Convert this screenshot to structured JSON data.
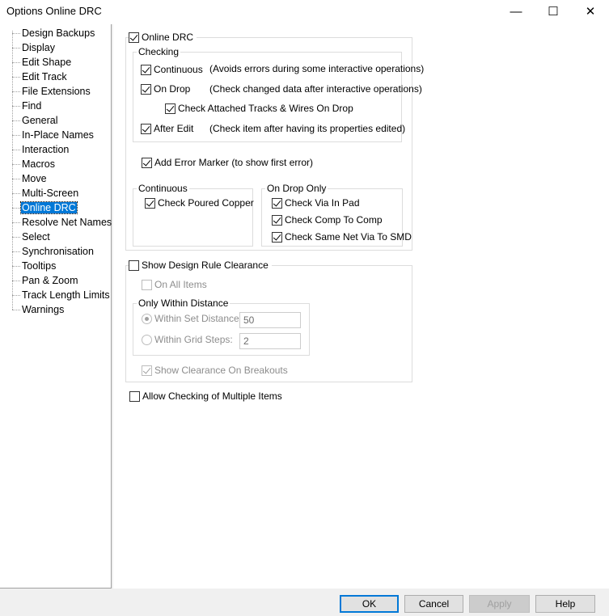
{
  "window": {
    "title": "Options  Online DRC",
    "controls": {
      "minimize": "—",
      "maximize": "☐",
      "close": "✕"
    }
  },
  "tree": {
    "items": [
      {
        "label": "Design Backups"
      },
      {
        "label": "Display"
      },
      {
        "label": "Edit Shape"
      },
      {
        "label": "Edit Track"
      },
      {
        "label": "File Extensions"
      },
      {
        "label": "Find"
      },
      {
        "label": "General"
      },
      {
        "label": "In-Place Names"
      },
      {
        "label": "Interaction"
      },
      {
        "label": "Macros"
      },
      {
        "label": "Move"
      },
      {
        "label": "Multi-Screen"
      },
      {
        "label": "Online DRC",
        "selected": true
      },
      {
        "label": "Resolve Net Names"
      },
      {
        "label": "Select"
      },
      {
        "label": "Synchronisation"
      },
      {
        "label": "Tooltips"
      },
      {
        "label": "Pan & Zoom"
      },
      {
        "label": "Track Length Limits"
      },
      {
        "label": "Warnings"
      }
    ]
  },
  "online_drc": {
    "label": "Online DRC",
    "checked": true,
    "checking": {
      "title": "Checking",
      "continuous": {
        "label": "Continuous",
        "checked": true,
        "note": "(Avoids errors during some interactive operations)"
      },
      "on_drop": {
        "label": "On Drop",
        "checked": true,
        "note": "(Check changed data after interactive operations)"
      },
      "attached": {
        "label": "Check Attached Tracks & Wires On Drop",
        "checked": true
      },
      "after_edit": {
        "label": "After Edit",
        "checked": true,
        "note": "(Check item after having its properties edited)"
      }
    },
    "error_marker": {
      "label": "Add Error Marker (to show first error)",
      "checked": true
    },
    "continuous_group": {
      "title": "Continuous",
      "poured_copper": {
        "label": "Check Poured Copper",
        "checked": true
      }
    },
    "on_drop_group": {
      "title": "On Drop Only",
      "via_in_pad": {
        "label": "Check Via In Pad",
        "checked": true
      },
      "comp_to_comp": {
        "label": "Check Comp To Comp",
        "checked": true
      },
      "same_net_via": {
        "label": "Check Same Net Via To SMD",
        "checked": true
      }
    }
  },
  "clearance": {
    "label": "Show Design Rule Clearance",
    "checked": false,
    "on_all_items": {
      "label": "On All Items",
      "checked": false
    },
    "within_distance": {
      "title": "Only Within Distance",
      "set_distance": {
        "label": "Within Set Distance:",
        "selected": true,
        "value": "50"
      },
      "grid_steps": {
        "label": "Within Grid Steps:",
        "selected": false,
        "value": "2"
      }
    },
    "breakouts": {
      "label": "Show Clearance On Breakouts",
      "checked": true
    }
  },
  "multiple_items": {
    "label": "Allow Checking of Multiple Items",
    "checked": false
  },
  "buttons": {
    "ok": "OK",
    "cancel": "Cancel",
    "apply": "Apply",
    "help": "Help"
  }
}
